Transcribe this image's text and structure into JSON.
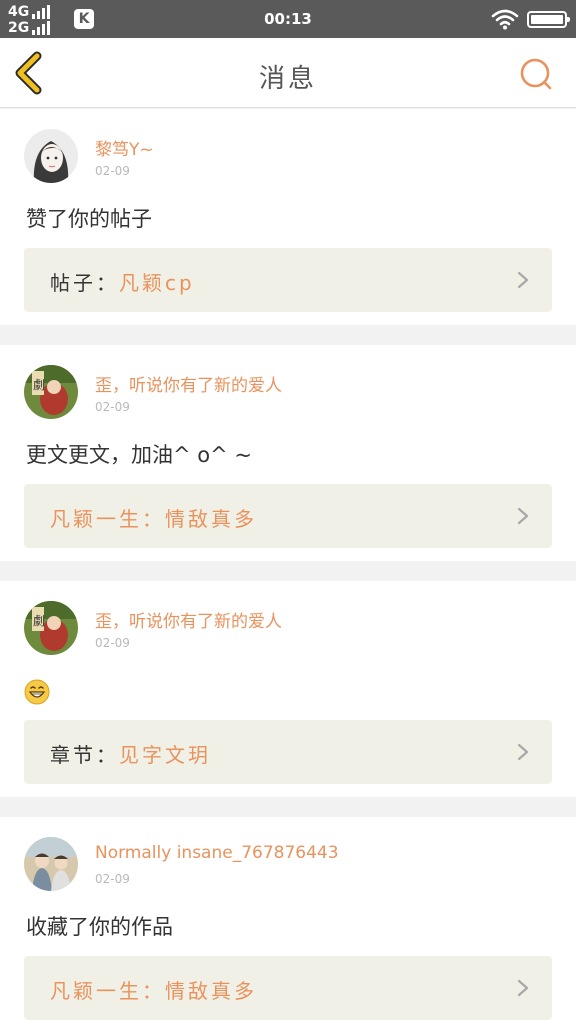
{
  "status_bar": {
    "net1": "4G",
    "net2": "2G",
    "badge": "K",
    "time": "00:13"
  },
  "header": {
    "title": "消息",
    "back_icon": "chevron-left-icon",
    "search_icon": "search-icon"
  },
  "colors": {
    "accent": "#e8935d",
    "back_arrow": "#f0c020",
    "link_bg": "#f1f0e6",
    "divider": "#f2f2f2"
  },
  "notifications": [
    {
      "user": "黎笃Y~",
      "date": "02-09",
      "message": "赞了你的帖子",
      "link_prefix": "帖子：",
      "link_title": "凡颖cp"
    },
    {
      "user": "歪，听说你有了新的爱人",
      "date": "02-09",
      "message": "更文更文，加油^ o^ ~",
      "link_prefix": "",
      "link_title": "凡颖一生：情敌真多"
    },
    {
      "user": "歪，听说你有了新的爱人",
      "date": "02-09",
      "message": "",
      "message_icon": "grinning-emoji-icon",
      "link_prefix": "章节：",
      "link_title": "见字文玥"
    },
    {
      "user": "Normally insane_767876443",
      "date": "02-09",
      "message": "收藏了你的作品",
      "link_prefix": "",
      "link_title": "凡颖一生：情敌真多"
    }
  ]
}
